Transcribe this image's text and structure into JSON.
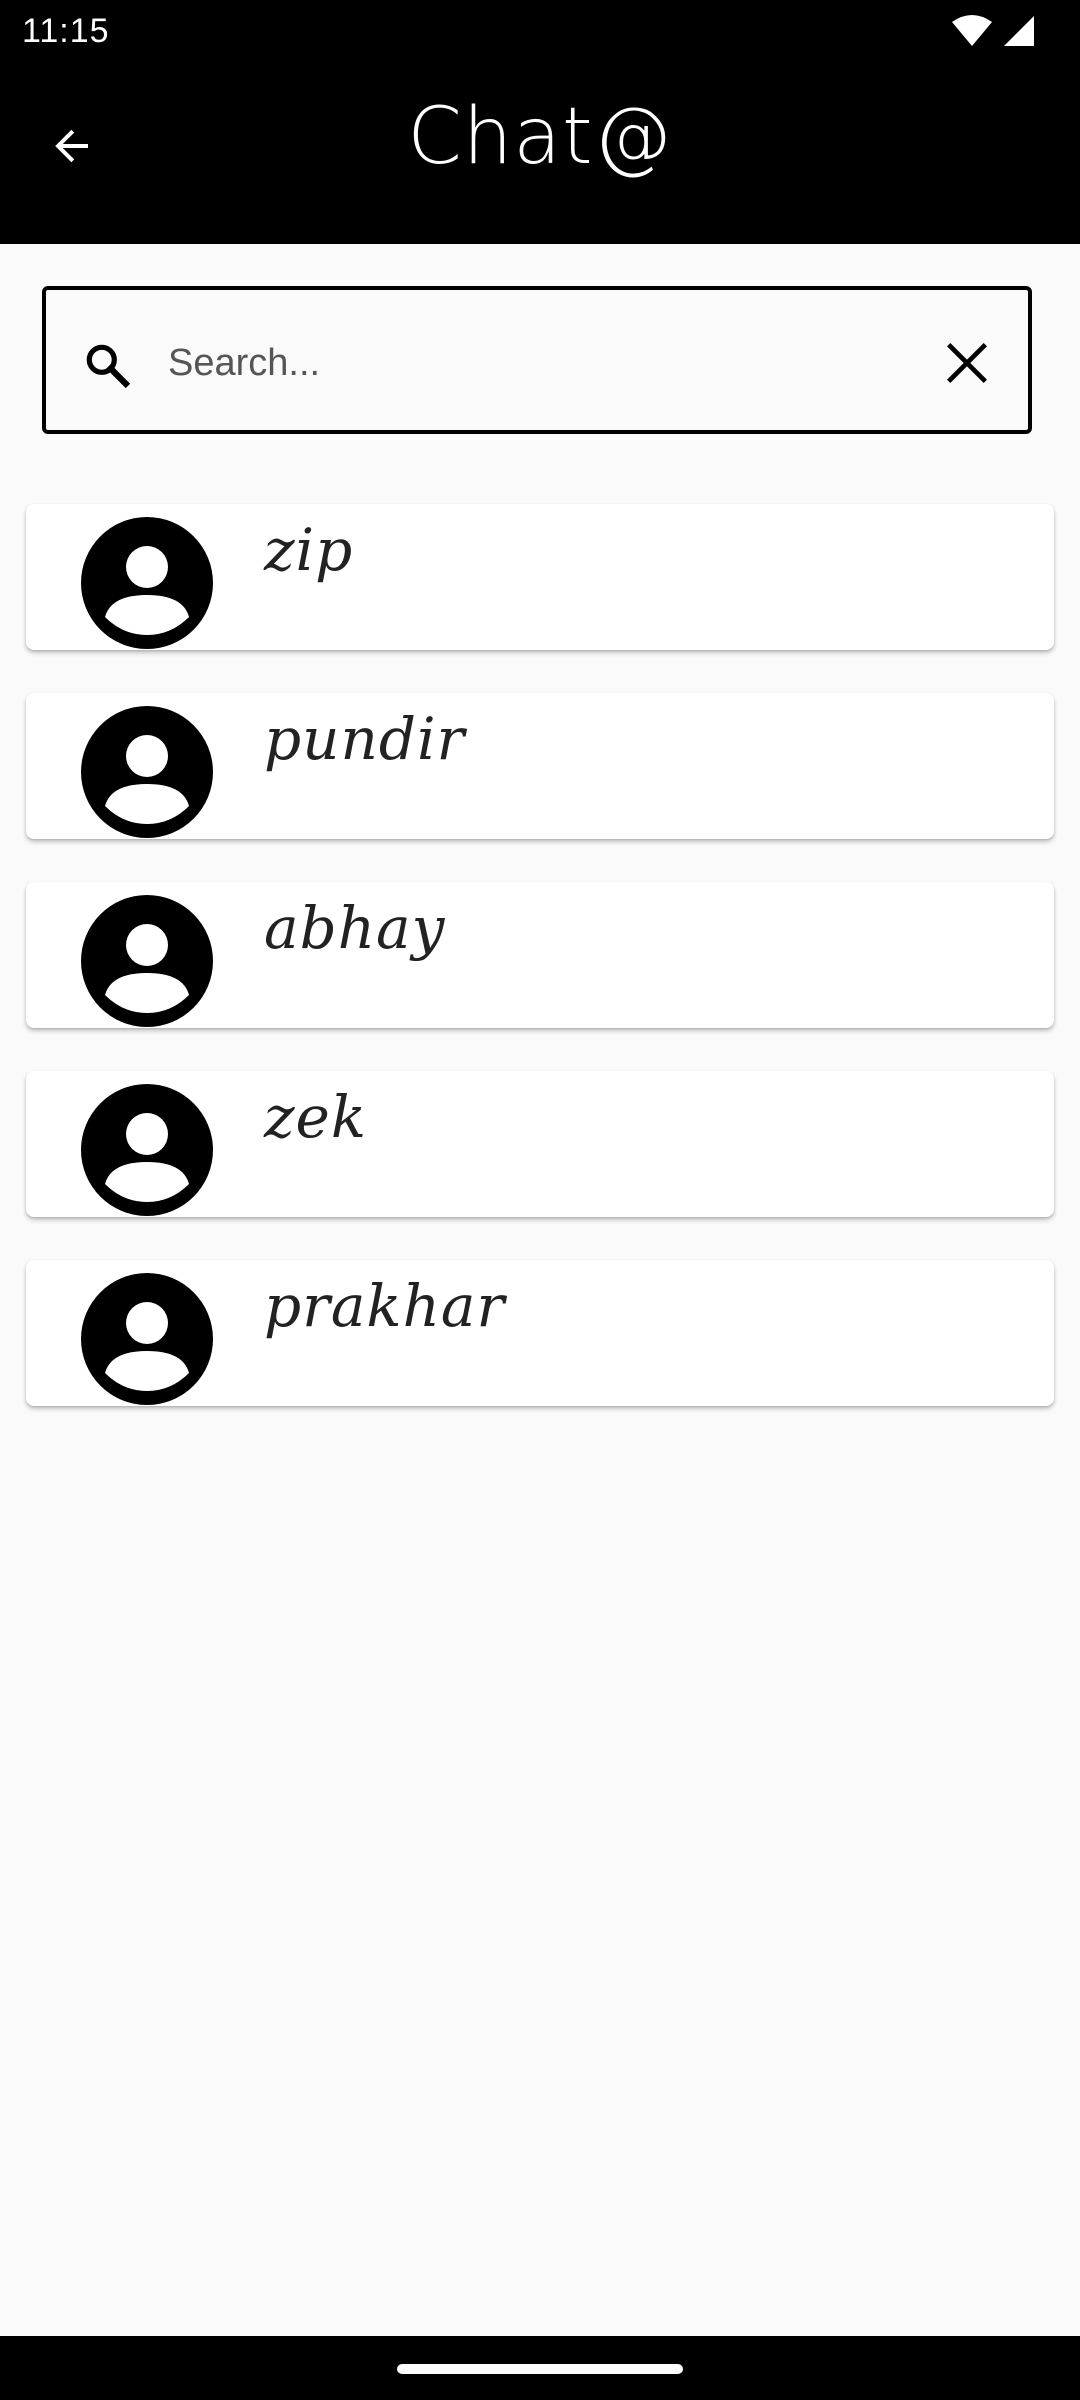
{
  "status_bar": {
    "time": "11:15",
    "icons": [
      "wifi-icon",
      "signal-icon"
    ]
  },
  "app_bar": {
    "title": "Chat@",
    "back_icon": "arrow-back-icon"
  },
  "search": {
    "placeholder": "Search...",
    "value": "",
    "search_icon": "search-icon",
    "clear_icon": "close-icon"
  },
  "contacts": [
    {
      "name": "zip"
    },
    {
      "name": "pundir"
    },
    {
      "name": "abhay"
    },
    {
      "name": "zek"
    },
    {
      "name": "prakhar"
    }
  ],
  "colors": {
    "app_bar": "#000000",
    "background": "#fafafa",
    "card": "#ffffff",
    "text": "#222222"
  }
}
